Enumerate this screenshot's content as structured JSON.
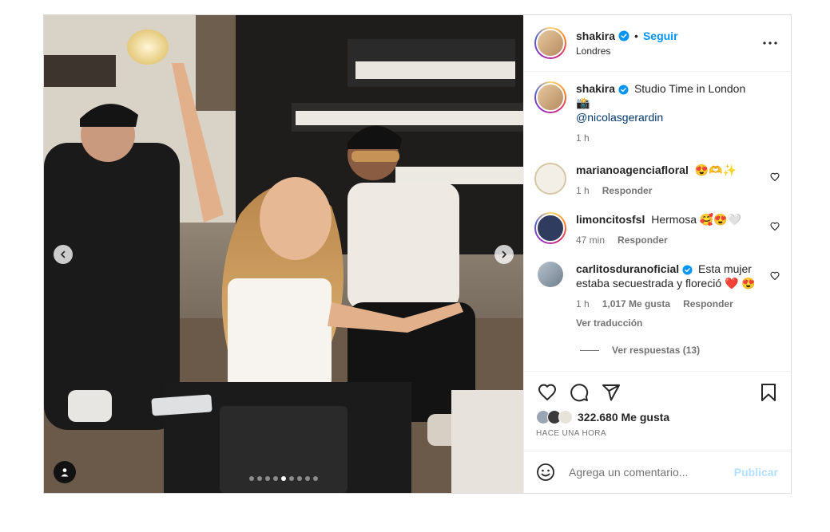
{
  "post": {
    "author": {
      "username": "shakira",
      "verified": true,
      "follow_label": "Seguir",
      "separator": "•",
      "location": "Londres"
    },
    "more_icon": "more-horizontal-icon",
    "media": {
      "carousel_total": 9,
      "carousel_current": 5,
      "prev_icon": "chevron-left-icon",
      "next_icon": "chevron-right-icon",
      "tag_icon": "user-tag-icon"
    },
    "caption": {
      "username": "shakira",
      "text": "Studio Time in London 📸",
      "mention": "@nicolasgerardin",
      "time": "1 h"
    },
    "comments": [
      {
        "username": "marianoagenciafloral",
        "text": "😍🫶✨",
        "time": "1 h",
        "reply_label": "Responder",
        "avatar_color": "#f3efe6"
      },
      {
        "username": "limoncitosfsl",
        "text": "Hermosa 🥰😍🤍",
        "time": "47 min",
        "reply_label": "Responder",
        "avatar_color": "#2f3c5f"
      },
      {
        "username": "carlitosduranoficial",
        "verified": true,
        "text": "Esta mujer estaba secuestrada y floreció ❤️ 😍",
        "time": "1 h",
        "likes": "1,017 Me gusta",
        "reply_label": "Responder",
        "translate_label": "Ver traducción",
        "replies_label": "Ver respuestas (13)",
        "avatar_color": "#8a98a8"
      }
    ],
    "actions": {
      "like_icon": "heart-icon",
      "comment_icon": "comment-icon",
      "share_icon": "send-icon",
      "save_icon": "bookmark-icon"
    },
    "likes_label": "322.680 Me gusta",
    "posted_ago": "HACE UNA HORA",
    "comment_box": {
      "emoji_icon": "emoji-icon",
      "placeholder": "Agrega un comentario...",
      "publish_label": "Publicar"
    },
    "colors": {
      "accent": "#0095f6",
      "text": "#262626",
      "muted": "#737373",
      "border": "#dbdbdb",
      "publish_disabled": "#b2dffc"
    }
  }
}
